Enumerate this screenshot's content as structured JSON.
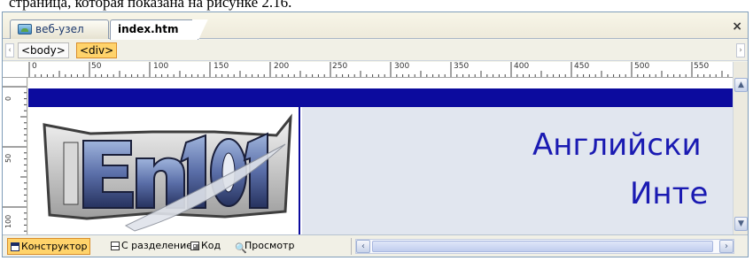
{
  "caption": "страница, которая показана на рисунке 2.16.",
  "tabs": {
    "web_node_label": "веб-узел",
    "document_label": "index.htm",
    "close_symbol": "×"
  },
  "tag_selector": {
    "body_tag": "<body>",
    "div_tag": "<div>",
    "scroll_left": "‹",
    "scroll_right": "›"
  },
  "ruler": {
    "marks": [
      "0",
      "50",
      "100",
      "150",
      "200",
      "250",
      "300",
      "350",
      "400",
      "450",
      "500",
      "550"
    ],
    "vertical_marks": [
      "0",
      "50",
      "100"
    ]
  },
  "page_preview": {
    "logo_alt": "En101",
    "title_line_1": "Английски",
    "title_line_2": "Инте",
    "band_color": "#0c0b9e",
    "title_color": "#1a1ab2"
  },
  "view_modes": {
    "design": "Конструктор",
    "split": "С разделением",
    "code": "Код",
    "preview": "Просмотр"
  },
  "scroll": {
    "up": "▲",
    "down": "▼",
    "left": "‹",
    "right": "›"
  },
  "colors": {
    "active_view": "#ffd36b",
    "selected_tag": "#ffd36b"
  }
}
